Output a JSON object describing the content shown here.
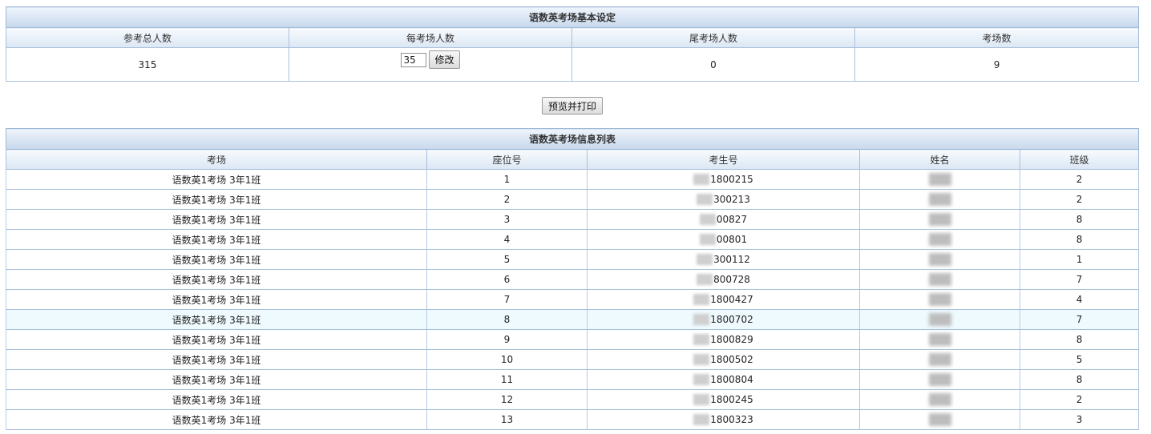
{
  "settings": {
    "title": "语数英考场基本设定",
    "headers": [
      "参考总人数",
      "每考场人数",
      "尾考场人数",
      "考场数"
    ],
    "total": "315",
    "per_room": "35",
    "modify_label": "修改",
    "last_room": "0",
    "room_count": "9"
  },
  "print_label": "预览并打印",
  "list": {
    "title": "语数英考场信息列表",
    "headers": [
      "考场",
      "座位号",
      "考生号",
      "姓名",
      "班级"
    ],
    "rows": [
      {
        "room": "语数英1考场 3年1班",
        "seat": "1",
        "id": "1800215",
        "cls": "2"
      },
      {
        "room": "语数英1考场 3年1班",
        "seat": "2",
        "id": "300213",
        "cls": "2"
      },
      {
        "room": "语数英1考场 3年1班",
        "seat": "3",
        "id": "00827",
        "cls": "8"
      },
      {
        "room": "语数英1考场 3年1班",
        "seat": "4",
        "id": "00801",
        "cls": "8"
      },
      {
        "room": "语数英1考场 3年1班",
        "seat": "5",
        "id": "300112",
        "cls": "1"
      },
      {
        "room": "语数英1考场 3年1班",
        "seat": "6",
        "id": "800728",
        "cls": "7"
      },
      {
        "room": "语数英1考场 3年1班",
        "seat": "7",
        "id": "1800427",
        "cls": "4"
      },
      {
        "room": "语数英1考场 3年1班",
        "seat": "8",
        "id": "1800702",
        "cls": "7"
      },
      {
        "room": "语数英1考场 3年1班",
        "seat": "9",
        "id": "1800829",
        "cls": "8"
      },
      {
        "room": "语数英1考场 3年1班",
        "seat": "10",
        "id": "1800502",
        "cls": "5"
      },
      {
        "room": "语数英1考场 3年1班",
        "seat": "11",
        "id": "1800804",
        "cls": "8"
      },
      {
        "room": "语数英1考场 3年1班",
        "seat": "12",
        "id": "1800245",
        "cls": "2"
      },
      {
        "room": "语数英1考场 3年1班",
        "seat": "13",
        "id": "1800323",
        "cls": "3"
      }
    ]
  }
}
